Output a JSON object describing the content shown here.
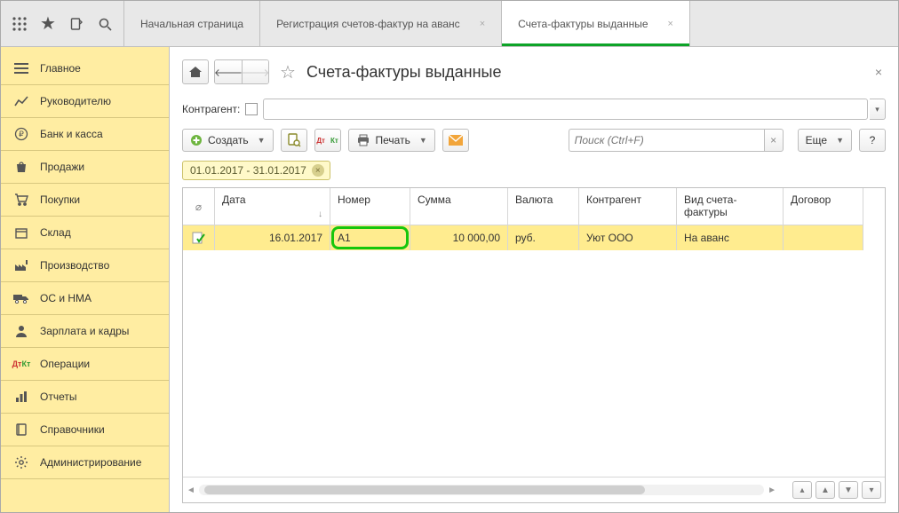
{
  "tabs": {
    "start": "Начальная страница",
    "reg": "Регистрация счетов-фактур на аванс",
    "active": "Счета-фактуры выданные"
  },
  "sidebar": {
    "items": [
      {
        "label": "Главное"
      },
      {
        "label": "Руководителю"
      },
      {
        "label": "Банк и касса"
      },
      {
        "label": "Продажи"
      },
      {
        "label": "Покупки"
      },
      {
        "label": "Склад"
      },
      {
        "label": "Производство"
      },
      {
        "label": "ОС и НМА"
      },
      {
        "label": "Зарплата и кадры"
      },
      {
        "label": "Операции"
      },
      {
        "label": "Отчеты"
      },
      {
        "label": "Справочники"
      },
      {
        "label": "Администрирование"
      }
    ]
  },
  "page": {
    "title": "Счета-фактуры выданные",
    "filter_label": "Контрагент:",
    "date_chip": "01.01.2017 - 31.01.2017"
  },
  "toolbar": {
    "create": "Создать",
    "print": "Печать",
    "more": "Еще",
    "help": "?",
    "search_placeholder": "Поиск (Ctrl+F)"
  },
  "table": {
    "headers": {
      "clip": "",
      "date": "Дата",
      "number": "Номер",
      "sum": "Сумма",
      "currency": "Валюта",
      "counterparty": "Контрагент",
      "kind": "Вид счета-фактуры",
      "contract": "Договор"
    },
    "rows": [
      {
        "date": "16.01.2017",
        "number": "А1",
        "sum": "10 000,00",
        "currency": "руб.",
        "counterparty": "Уют ООО",
        "kind": "На аванс",
        "contract": ""
      }
    ]
  }
}
